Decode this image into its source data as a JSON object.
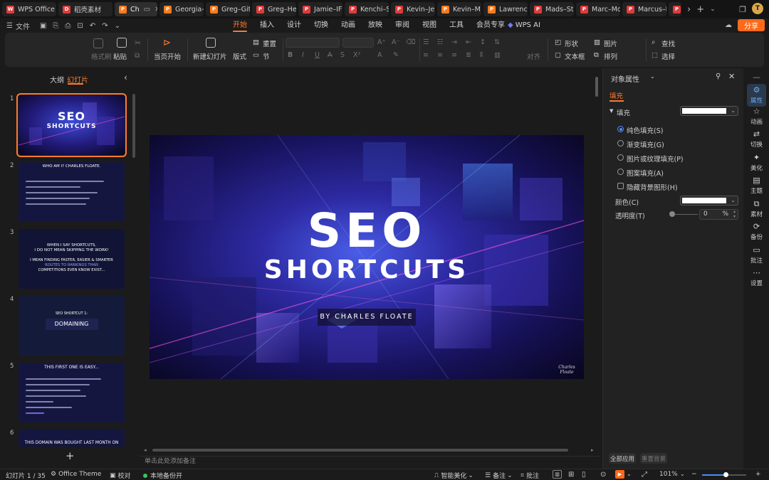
{
  "tabs": [
    {
      "label": "WPS Office",
      "color": "#e13a3a",
      "glyph": "W"
    },
    {
      "label": "稻壳素材",
      "color": "#e13a3a",
      "glyph": "D"
    },
    {
      "label": "Ch",
      "color": "#ff7a1a",
      "glyph": "P",
      "active": true
    },
    {
      "label": "Georgia-",
      "color": "#ff7a1a",
      "glyph": "P"
    },
    {
      "label": "Greg–Git",
      "color": "#ff7a1a",
      "glyph": "P"
    },
    {
      "label": "Greg–He",
      "color": "#e13a3a",
      "glyph": "P"
    },
    {
      "label": "Jamie–IF",
      "color": "#e13a3a",
      "glyph": "P"
    },
    {
      "label": "Kenchi–S",
      "color": "#e13a3a",
      "glyph": "P"
    },
    {
      "label": "Kevin–Je",
      "color": "#e13a3a",
      "glyph": "P"
    },
    {
      "label": "Kevin–M",
      "color": "#ff7a1a",
      "glyph": "P"
    },
    {
      "label": "Lawrence",
      "color": "#ff7a1a",
      "glyph": "P"
    },
    {
      "label": "Mads–Sti",
      "color": "#e13a3a",
      "glyph": "P"
    },
    {
      "label": "Marc–Mo",
      "color": "#e13a3a",
      "glyph": "P"
    },
    {
      "label": "Marcus–I",
      "color": "#e13a3a",
      "glyph": "P"
    },
    {
      "label": "N",
      "color": "#e13a3a",
      "glyph": "P"
    }
  ],
  "menu": {
    "file": "文件",
    "items": [
      "开始",
      "插入",
      "设计",
      "切换",
      "动画",
      "放映",
      "审阅",
      "视图",
      "工具",
      "会员专享"
    ],
    "active": "开始",
    "wps_ai": "WPS AI",
    "share": "分享"
  },
  "ribbon": {
    "format_painter": "格式刷",
    "paste": "粘贴",
    "from_start": "当页开始",
    "new_slide": "新建幻灯片",
    "layout": "版式",
    "section": "节",
    "reset": "重置",
    "align": "对齐",
    "shape": "形状",
    "picture": "图片",
    "textbox": "文本框",
    "arrange": "排列",
    "find": "查找",
    "select": "选择"
  },
  "left_panel": {
    "outline_tab": "大纲",
    "slides_tab": "幻灯片",
    "slides": [
      {
        "num": "1",
        "title": "SEO",
        "subtitle": "SHORTCUTS"
      },
      {
        "num": "2",
        "title": "WHO AM I? CHARLES FLOATE."
      },
      {
        "num": "3",
        "line1": "WHEN I SAY SHORTCUTS,",
        "line2": "I DO NOT MEAN SKIPPING THE WORK!",
        "line3": "I MEAN FINDING FASTER, EASIER & SMARTER",
        "line4": "ROUTES TO RANKINGS THAN",
        "line5": "COMPETITIONS EVEN KNOW EXIST..."
      },
      {
        "num": "4",
        "small": "SEO SHORTCUT 1:",
        "title": "DOMAINING"
      },
      {
        "num": "5",
        "title": "THIS FIRST ONE IS EASY..."
      },
      {
        "num": "6",
        "title": "THIS DOMAIN WAS BOUGHT LAST MONTH ON"
      }
    ],
    "add_symbol": "+"
  },
  "slide": {
    "title": "SEO",
    "subtitle": "SHORTCUTS",
    "byline": "BY CHARLES FLOATE",
    "signature": "Charles Floate"
  },
  "notes_placeholder": "单击此处添加备注",
  "properties": {
    "header": "对象属性",
    "fill_tab": "填充",
    "fill_label": "填充",
    "options": [
      "纯色填充(S)",
      "渐变填充(G)",
      "图片或纹理填充(P)",
      "图案填充(A)"
    ],
    "selected_option": 0,
    "hide_bg": "隐藏背景图形(H)",
    "color_label": "颜色(C)",
    "transparency_label": "透明度(T)",
    "transparency_value": "0",
    "transparency_unit": "%",
    "apply_all": "全部应用",
    "reset_bg": "重置背景"
  },
  "rail": [
    {
      "label": "属性",
      "icon": "sliders-icon",
      "active": true
    },
    {
      "label": "动画",
      "icon": "star-icon"
    },
    {
      "label": "切换",
      "icon": "transition-icon"
    },
    {
      "label": "美化",
      "icon": "magic-icon"
    },
    {
      "label": "主题",
      "icon": "theme-icon"
    },
    {
      "label": "素材",
      "icon": "material-icon"
    },
    {
      "label": "备份",
      "icon": "backup-icon"
    },
    {
      "label": "批注",
      "icon": "comment-icon"
    },
    {
      "label": "设置",
      "icon": "more-icon"
    }
  ],
  "status": {
    "slide_counter": "幻灯片 1 / 35",
    "theme": "Office Theme",
    "proofread": "校对",
    "backup": "本地备份开",
    "beautify": "智能美化",
    "notes": "备注",
    "comments": "批注",
    "zoom": "101%"
  },
  "colors": {
    "accent": "#ff7a2e",
    "selection_blue": "#4a8cff"
  }
}
